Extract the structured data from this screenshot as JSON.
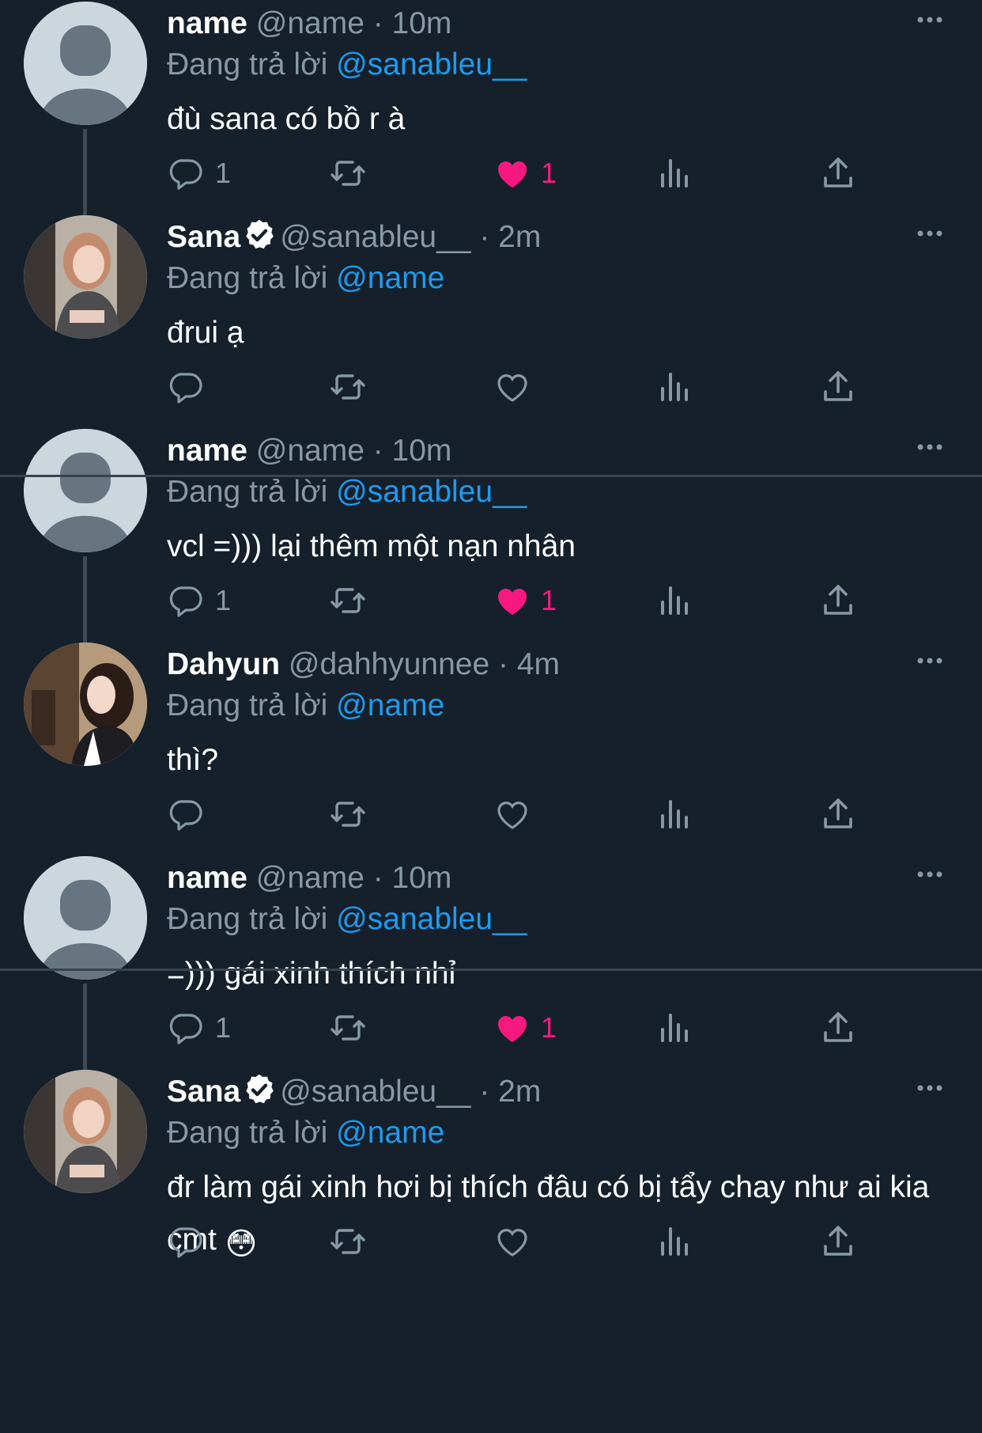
{
  "colors": {
    "background": "#15202b",
    "muted": "#8899a6",
    "mention": "#1d9bf0",
    "like": "#f91880",
    "divider": "#38444d"
  },
  "icons": {
    "reply": "reply-icon",
    "retweet": "retweet-icon",
    "like": "heart-icon",
    "views": "views-icon",
    "share": "share-icon",
    "more": "more-icon",
    "verified": "verified-badge-icon"
  },
  "tweets": [
    {
      "name": "name",
      "handle": "@name",
      "time": "· 10m",
      "reply_prefix": "Đang trả lời",
      "reply_to": "@sanableu__",
      "text": "đù sana có bồ r à",
      "reply_count": "1",
      "like_count": "1",
      "liked": true,
      "avatar": "default-avatar"
    },
    {
      "name": "Sana",
      "handle": "@sanableu__",
      "time": "· 2m",
      "reply_prefix": "Đang trả lời",
      "reply_to": "@name",
      "text": "đrui ạ",
      "reply_count": "",
      "like_count": "",
      "liked": false,
      "verified": true,
      "avatar": "sana-photo"
    },
    {
      "name": "name",
      "handle": "@name",
      "time": "· 10m",
      "reply_prefix": "Đang trả lời",
      "reply_to": "@sanableu__",
      "text": "vcl =))) lại thêm một nạn nhân",
      "reply_count": "1",
      "like_count": "1",
      "liked": true,
      "avatar": "default-avatar"
    },
    {
      "name": "Dahyun",
      "handle": "@dahhyunnee",
      "time": "· 4m",
      "reply_prefix": "Đang trả lời",
      "reply_to": "@name",
      "text": "thì?",
      "reply_count": "",
      "like_count": "",
      "liked": false,
      "avatar": "dahyun-photo"
    },
    {
      "name": "name",
      "handle": "@name",
      "time": "· 10m",
      "reply_prefix": "Đang trả lời",
      "reply_to": "@sanableu__",
      "text": "=))) gái xinh thích nhỉ",
      "reply_count": "1",
      "like_count": "1",
      "liked": true,
      "avatar": "default-avatar"
    },
    {
      "name": "Sana",
      "handle": "@sanableu__",
      "time": "· 2m",
      "reply_prefix": "Đang trả lời",
      "reply_to": "@name",
      "text": "đr làm gái xinh hơi bị thích đâu có bị tẩy chay như ai kia cmt",
      "emoji": "😳",
      "reply_count": "",
      "like_count": "",
      "liked": false,
      "verified": true,
      "avatar": "sana-photo"
    }
  ]
}
